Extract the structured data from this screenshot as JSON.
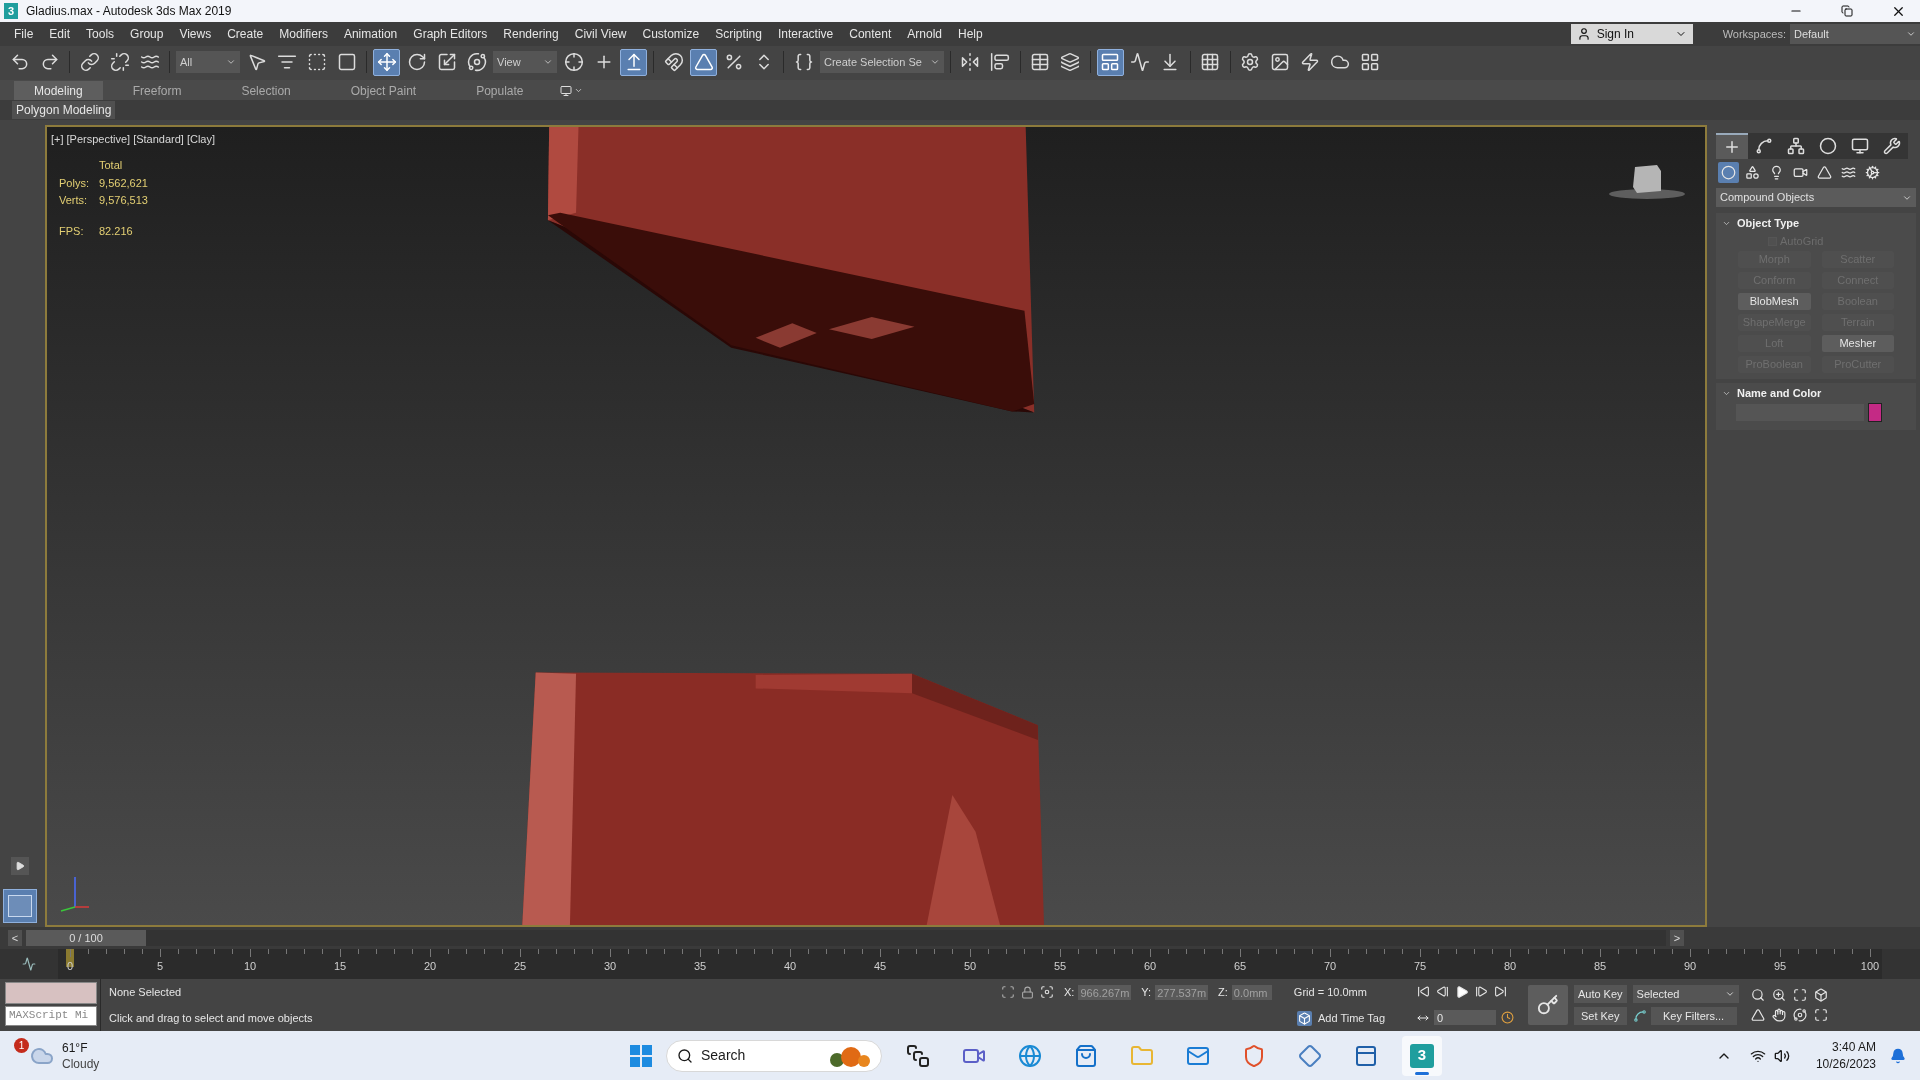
{
  "window": {
    "icon_label": "3",
    "title": "Gladius.max - Autodesk 3ds Max 2019"
  },
  "menu": [
    "File",
    "Edit",
    "Tools",
    "Group",
    "Views",
    "Create",
    "Modifiers",
    "Animation",
    "Graph Editors",
    "Rendering",
    "Civil View",
    "Customize",
    "Scripting",
    "Interactive",
    "Content",
    "Arnold",
    "Help"
  ],
  "account": {
    "sign_in": "Sign In",
    "workspaces_label": "Workspaces:",
    "workspace": "Default"
  },
  "toolbar": [
    {
      "kind": "button",
      "selected": false
    },
    {
      "kind": "button",
      "selected": false
    },
    {
      "kind": "separator"
    },
    {
      "kind": "button",
      "selected": false
    },
    {
      "kind": "button",
      "selected": false
    },
    {
      "kind": "button",
      "selected": false
    },
    {
      "kind": "separator"
    },
    {
      "kind": "dropdown",
      "value": "All"
    },
    {
      "kind": "button",
      "selected": false
    },
    {
      "kind": "button",
      "selected": false
    },
    {
      "kind": "button",
      "selected": false
    },
    {
      "kind": "button",
      "selected": false
    },
    {
      "kind": "separator"
    },
    {
      "kind": "button",
      "selected": true
    },
    {
      "kind": "button",
      "selected": false
    },
    {
      "kind": "button",
      "selected": false
    },
    {
      "kind": "button",
      "selected": false
    },
    {
      "kind": "dropdown",
      "value": "View"
    },
    {
      "kind": "button",
      "selected": false
    },
    {
      "kind": "button",
      "selected": false
    },
    {
      "kind": "button",
      "selected": true
    },
    {
      "kind": "separator"
    },
    {
      "kind": "button",
      "selected": false
    },
    {
      "kind": "button",
      "selected": true
    },
    {
      "kind": "button",
      "selected": false
    },
    {
      "kind": "button",
      "selected": false
    },
    {
      "kind": "separator"
    },
    {
      "kind": "button",
      "selected": false
    },
    {
      "kind": "dropdown",
      "value": "Create Selection Se"
    },
    {
      "kind": "separator"
    },
    {
      "kind": "button",
      "selected": false
    },
    {
      "kind": "button",
      "selected": false
    },
    {
      "kind": "separator"
    },
    {
      "kind": "button",
      "selected": false
    },
    {
      "kind": "button",
      "selected": false
    },
    {
      "kind": "separator"
    },
    {
      "kind": "button",
      "selected": true
    },
    {
      "kind": "button",
      "selected": false
    },
    {
      "kind": "button",
      "selected": false
    },
    {
      "kind": "separator"
    },
    {
      "kind": "button",
      "selected": false
    },
    {
      "kind": "separator"
    },
    {
      "kind": "button",
      "selected": false
    },
    {
      "kind": "button",
      "selected": false
    },
    {
      "kind": "button",
      "selected": false
    },
    {
      "kind": "button",
      "selected": false
    },
    {
      "kind": "button",
      "selected": false
    }
  ],
  "ribbon": {
    "tabs": [
      {
        "label": "Modeling",
        "selected": true
      },
      {
        "label": "Freeform",
        "selected": false
      },
      {
        "label": "Selection",
        "selected": false
      },
      {
        "label": "Object Paint",
        "selected": false
      },
      {
        "label": "Populate",
        "selected": false
      }
    ],
    "panel": "Polygon Modeling"
  },
  "viewport": {
    "labels": [
      "[+]",
      "[Perspective]",
      "[Standard]",
      "[Clay]"
    ],
    "stats": {
      "header": "Total",
      "rows": [
        {
          "label": "Polys:",
          "value": "9,562,621"
        },
        {
          "label": "Verts:",
          "value": "9,576,513"
        }
      ],
      "fps_label": "FPS:",
      "fps": "82.216"
    }
  },
  "command_panel": {
    "tabs": [
      {
        "selected": true
      },
      {
        "selected": false
      },
      {
        "selected": false
      },
      {
        "selected": false
      },
      {
        "selected": false
      },
      {
        "selected": false
      }
    ],
    "categories": [
      {
        "selected": true
      },
      {
        "selected": false
      },
      {
        "selected": false
      },
      {
        "selected": false
      },
      {
        "selected": false
      },
      {
        "selected": false
      },
      {
        "selected": false
      }
    ],
    "dropdown": "Compound Objects",
    "object_type": {
      "title": "Object Type",
      "autogrid": {
        "label": "AutoGrid",
        "checked": false,
        "disabled": true
      },
      "buttons": [
        {
          "label": "Morph",
          "disabled": true
        },
        {
          "label": "Scatter",
          "disabled": true
        },
        {
          "label": "Conform",
          "disabled": true
        },
        {
          "label": "Connect",
          "disabled": true
        },
        {
          "label": "BlobMesh",
          "disabled": false
        },
        {
          "label": "Boolean",
          "disabled": true
        },
        {
          "label": "ShapeMerge",
          "disabled": true
        },
        {
          "label": "Terrain",
          "disabled": true
        },
        {
          "label": "Loft",
          "disabled": true
        },
        {
          "label": "Mesher",
          "disabled": false
        },
        {
          "label": "ProBoolean",
          "disabled": true
        },
        {
          "label": "ProCutter",
          "disabled": true
        }
      ]
    },
    "name_and_color": {
      "title": "Name and Color",
      "color": "#c42a85"
    }
  },
  "time_slider": {
    "prev": "<",
    "position": "0 / 100",
    "next": ">",
    "level": 0
  },
  "track": {
    "ticks": [
      "0",
      "5",
      "10",
      "15",
      "20",
      "25",
      "30",
      "35",
      "40",
      "45",
      "50",
      "55",
      "60",
      "65",
      "70",
      "75",
      "80",
      "85",
      "90",
      "95",
      "100"
    ]
  },
  "status": {
    "maxscript": "MAXScript Mi",
    "selection": "None Selected",
    "prompt": "Click and drag to select and move objects",
    "coords": [
      {
        "label": "X:",
        "value": "966.267m"
      },
      {
        "label": "Y:",
        "value": "277.537m"
      },
      {
        "label": "Z:",
        "value": "0.0mm"
      }
    ],
    "grid": "Grid = 10.0mm",
    "add_time_tag": "Add Time Tag",
    "frame": "0",
    "auto_key": "Auto Key",
    "key_mode": "Selected",
    "set_key": "Set Key",
    "key_filters": "Key Filters..."
  },
  "taskbar": {
    "weather": {
      "badge": "1",
      "temp": "61°F",
      "condition": "Cloudy"
    },
    "search": "Search",
    "apps": [
      {
        "selected": false
      },
      {
        "selected": false
      },
      {
        "selected": false
      },
      {
        "selected": false
      },
      {
        "selected": false
      },
      {
        "selected": false
      },
      {
        "selected": false
      },
      {
        "selected": false
      },
      {
        "selected": false
      },
      {
        "label": "3",
        "selected": true
      }
    ],
    "time": "3:40 AM",
    "date": "10/26/2023"
  }
}
